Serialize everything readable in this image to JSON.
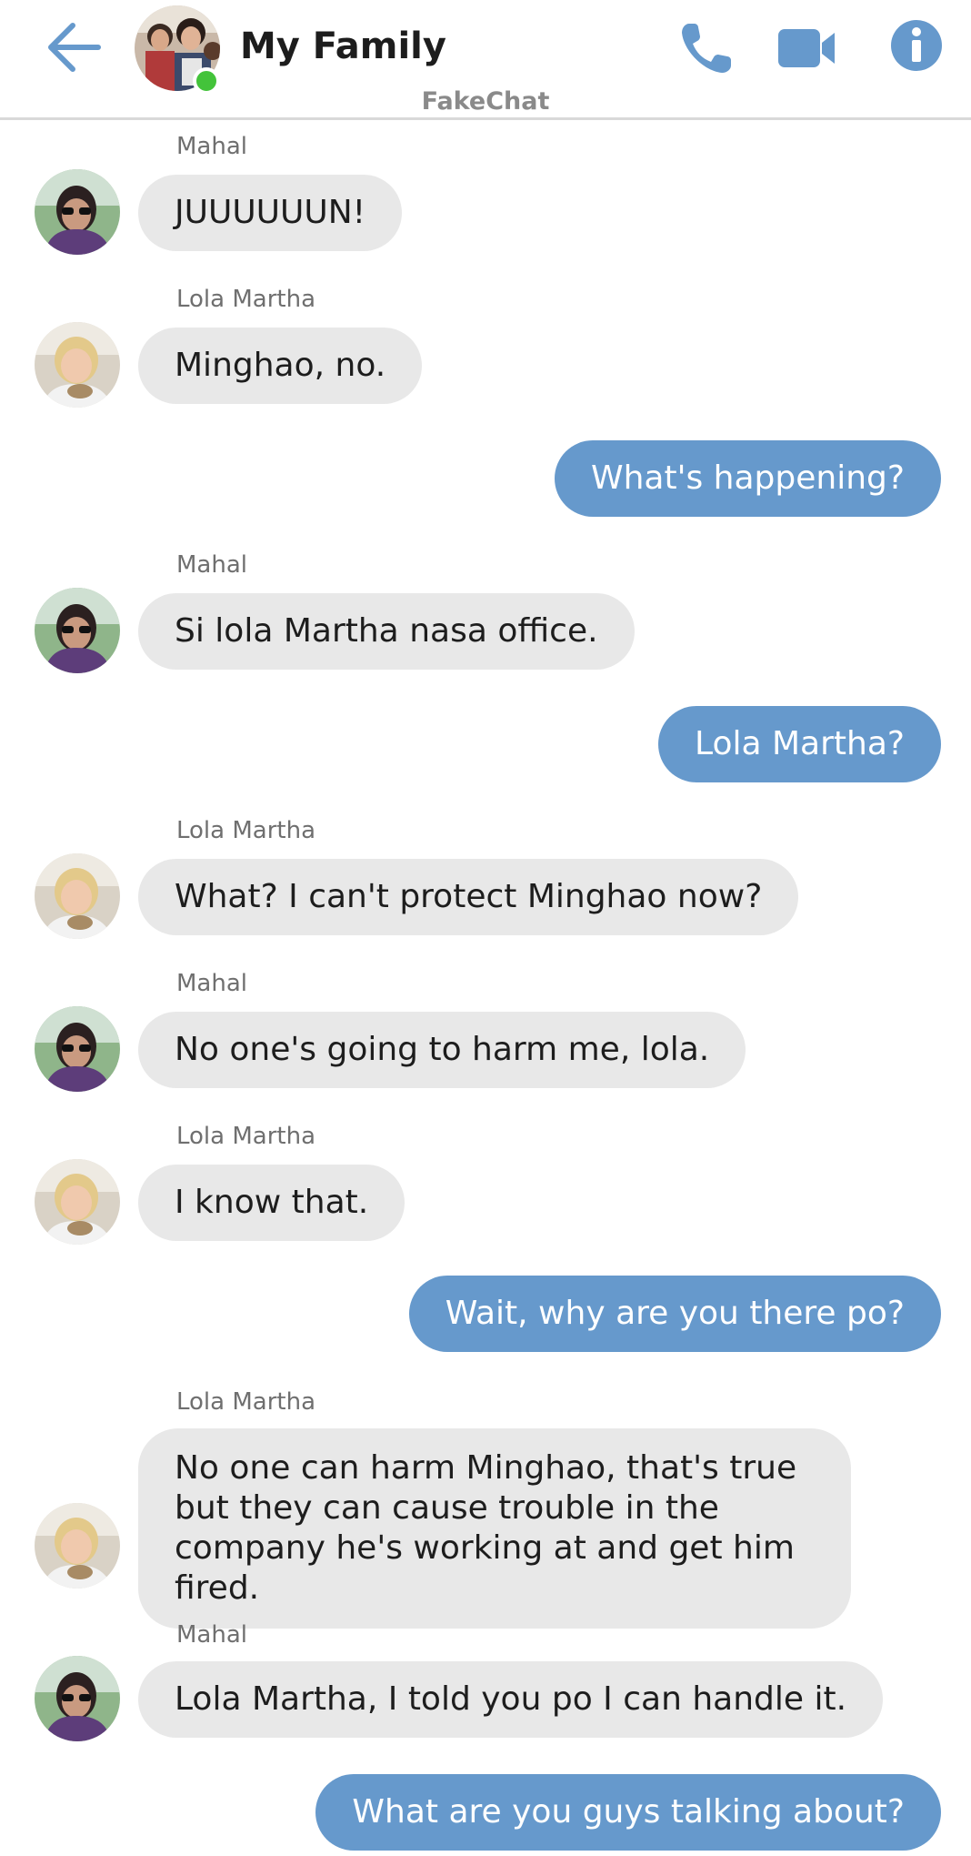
{
  "header": {
    "title": "My Family",
    "app_name": "FakeChat"
  },
  "colors": {
    "accent": "#6699cc",
    "incoming_bubble": "#e8e8e8",
    "online": "#43c33a"
  },
  "icons": {
    "back": "arrow-left-icon",
    "call": "phone-icon",
    "video": "video-camera-icon",
    "info": "info-icon"
  },
  "messages": [
    {
      "sender": "Mahal",
      "text": "JUUUUUUN!",
      "direction": "incoming"
    },
    {
      "sender": "Lola Martha",
      "text": "Minghao, no.",
      "direction": "incoming"
    },
    {
      "text": "What's happening?",
      "direction": "outgoing"
    },
    {
      "sender": "Mahal",
      "text": "Si lola Martha nasa office.",
      "direction": "incoming"
    },
    {
      "text": "Lola Martha?",
      "direction": "outgoing"
    },
    {
      "sender": "Lola Martha",
      "text": "What? I can't protect Minghao now?",
      "direction": "incoming"
    },
    {
      "sender": "Mahal",
      "text": "No one's going to harm me, lola.",
      "direction": "incoming"
    },
    {
      "sender": "Lola Martha",
      "text": "I know that.",
      "direction": "incoming"
    },
    {
      "text": "Wait, why are you there po?",
      "direction": "outgoing"
    },
    {
      "sender": "Lola Martha",
      "text": "No one can harm Minghao, that's true but they can cause trouble in the company he's working at and get him fired.",
      "direction": "incoming"
    },
    {
      "sender": "Mahal",
      "text": "Lola Martha, I told you po I can handle it.",
      "direction": "incoming"
    },
    {
      "text": "What are you guys talking about?",
      "direction": "outgoing"
    }
  ]
}
